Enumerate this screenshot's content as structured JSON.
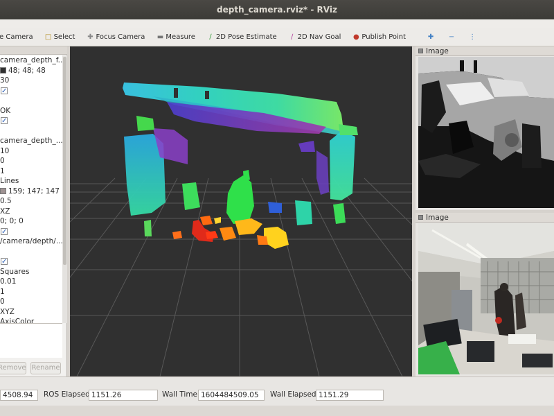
{
  "window": {
    "title": "depth_camera.rviz* - RViz"
  },
  "toolbar": {
    "tools": [
      {
        "label": "e Camera",
        "icon": "camera-icon"
      },
      {
        "label": "Select",
        "icon": "select-icon"
      },
      {
        "label": "Focus Camera",
        "icon": "focus-camera-icon"
      },
      {
        "label": "Measure",
        "icon": "measure-icon"
      },
      {
        "label": "2D Pose Estimate",
        "icon": "pose-estimate-icon"
      },
      {
        "label": "2D Nav Goal",
        "icon": "nav-goal-icon"
      },
      {
        "label": "Publish Point",
        "icon": "publish-point-icon"
      }
    ],
    "extra_icons": [
      "add-tool-icon",
      "remove-tool-icon",
      "tool-options-icon"
    ]
  },
  "displays": {
    "rows": [
      {
        "text": "camera_depth_f..."
      },
      {
        "text": "48; 48; 48",
        "swatch": "#303030"
      },
      {
        "text": "30"
      },
      {
        "check": "✓"
      },
      {
        "text": ""
      },
      {
        "text": "OK"
      },
      {
        "check": "✓"
      },
      {
        "text": ""
      },
      {
        "text": "camera_depth_..."
      },
      {
        "text": "10"
      },
      {
        "text": "0"
      },
      {
        "text": "1"
      },
      {
        "text": "Lines"
      },
      {
        "text": "159; 147; 147",
        "swatch": "#9f9393"
      },
      {
        "text": "0.5"
      },
      {
        "text": "XZ"
      },
      {
        "text": "0; 0; 0"
      },
      {
        "check": "✓"
      },
      {
        "text": "/camera/depth/..."
      },
      {
        "text": ""
      },
      {
        "check": "✓"
      },
      {
        "text": "Squares"
      },
      {
        "text": "0.01"
      },
      {
        "text": "1"
      },
      {
        "text": "0"
      },
      {
        "text": "XYZ"
      },
      {
        "text": "AxisColor"
      }
    ],
    "buttons": {
      "remove": "Remove",
      "rename": "Rename"
    }
  },
  "image_panels": [
    {
      "title": "Image",
      "kind": "depth image"
    },
    {
      "title": "Image",
      "kind": "color image"
    }
  ],
  "time": {
    "ros_time_value": "4508.94",
    "ros_elapsed_label": "ROS Elapsed:",
    "ros_elapsed_value": "1151.26",
    "wall_time_label": "Wall Time:",
    "wall_time_value": "1604484509.05",
    "wall_elapsed_label": "Wall Elapsed:",
    "wall_elapsed_value": "1151.29"
  },
  "colors": {
    "view_background": "#303030",
    "grid": "#6a6a6a",
    "check_blue": "#2a5fb8"
  }
}
